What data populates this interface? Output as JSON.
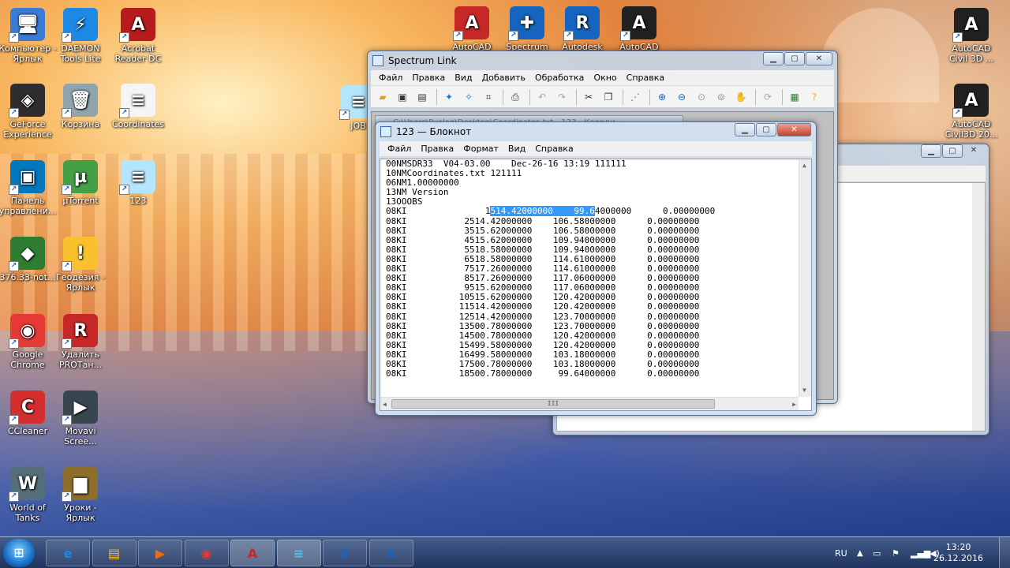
{
  "desktop_icons_left": [
    {
      "label": "Компьютер - Ярлык",
      "icon": "computer-icon",
      "color": "#3a7bd5",
      "glyph": "🖥"
    },
    {
      "label": "DAEMON Tools Lite",
      "icon": "daemon-tools-icon",
      "color": "#1e88e5",
      "glyph": "⚡"
    },
    {
      "label": "Acrobat Reader DC",
      "icon": "acrobat-icon",
      "color": "#b71c1c",
      "glyph": "A"
    },
    {
      "label": "GeForce Experience",
      "icon": "geforce-icon",
      "color": "#2e2e2e",
      "glyph": "◈"
    },
    {
      "label": "Корзина",
      "icon": "recycle-bin-icon",
      "color": "#90a4ae",
      "glyph": "🗑"
    },
    {
      "label": "Coordinates",
      "icon": "text-file-icon",
      "color": "#f5f5f5",
      "glyph": "≡"
    },
    {
      "label": "Панель управлени...",
      "icon": "intel-panel-icon",
      "color": "#0277bd",
      "glyph": "▣"
    },
    {
      "label": "µTorrent",
      "icon": "utorrent-icon",
      "color": "#43a047",
      "glyph": "µ"
    },
    {
      "label": "123",
      "icon": "notepad-file-icon",
      "color": "#b3e5fc",
      "glyph": "≡"
    },
    {
      "label": "376.33-not...",
      "icon": "nvidia-icon",
      "color": "#2e7d32",
      "glyph": "◆"
    },
    {
      "label": "Геодезия - Ярлык",
      "icon": "warning-icon",
      "color": "#fbc02d",
      "glyph": "!"
    },
    {
      "label": "Google Chrome",
      "icon": "chrome-icon",
      "color": "#e53935",
      "glyph": "◉"
    },
    {
      "label": "Удалить PROTан...",
      "icon": "uninstall-icon",
      "color": "#c62828",
      "glyph": "R"
    },
    {
      "label": "CCleaner",
      "icon": "ccleaner-icon",
      "color": "#d32f2f",
      "glyph": "C"
    },
    {
      "label": "Movavi Scree...",
      "icon": "movavi-icon",
      "color": "#37474f",
      "glyph": "▶"
    },
    {
      "label": "World of Tanks",
      "icon": "wot-icon",
      "color": "#546e7a",
      "glyph": "W"
    },
    {
      "label": "Уроки - Ярлык",
      "icon": "folder-icon",
      "color": "#8d6e2a",
      "glyph": "▆"
    }
  ],
  "desktop_icons_top": [
    {
      "label": "AutoCAD",
      "icon": "autocad-icon",
      "color": "#c62828",
      "glyph": "A"
    },
    {
      "label": "Spectrum",
      "icon": "spectrum-icon",
      "color": "#1565c0",
      "glyph": "✚"
    },
    {
      "label": "Autodesk",
      "icon": "autodesk-icon",
      "color": "#1565c0",
      "glyph": "R"
    },
    {
      "label": "AutoCAD",
      "icon": "autocad-c3d-icon",
      "color": "#212121",
      "glyph": "A"
    },
    {
      "label": "JOB",
      "icon": "job-file-icon",
      "color": "#b3e5fc",
      "glyph": "≡"
    }
  ],
  "desktop_icons_right": [
    {
      "label": "AutoCAD Civil 3D ...",
      "icon": "civil3d-icon",
      "color": "#212121",
      "glyph": "A"
    },
    {
      "label": "AutoCAD Civil3D 20...",
      "icon": "civil3d-2-icon",
      "color": "#212121",
      "glyph": "A"
    }
  ],
  "spectrum": {
    "title": "Spectrum Link",
    "menu": [
      "Файл",
      "Правка",
      "Вид",
      "Добавить",
      "Обработка",
      "Окно",
      "Справка"
    ],
    "inner_title": "C:\\Users\\Ruslan\\Desktop\\Coordinates.txt - 123 - Коорди..."
  },
  "notepad": {
    "title": "123 — Блокнот",
    "menu": [
      "Файл",
      "Правка",
      "Формат",
      "Вид",
      "Справка"
    ],
    "header_lines": [
      "00NMSDR33  V04-03.00    Dec-26-16 13:19 111111",
      "10NMCoordinates.txt 121111",
      "06NM1.00000000",
      "13NM Version",
      "13OOOBS"
    ],
    "first_row": {
      "tag": "08KI",
      "col1_pre": "1",
      "col1_sel": "514.42000000",
      "col2_sel": "99.6",
      "col2_post": "4000000",
      "col3": "0.00000000"
    },
    "rows": [
      [
        "08KI",
        "2514.42000000",
        "106.58000000",
        "0.00000000"
      ],
      [
        "08KI",
        "3515.62000000",
        "106.58000000",
        "0.00000000"
      ],
      [
        "08KI",
        "4515.62000000",
        "109.94000000",
        "0.00000000"
      ],
      [
        "08KI",
        "5518.58000000",
        "109.94000000",
        "0.00000000"
      ],
      [
        "08KI",
        "6518.58000000",
        "114.61000000",
        "0.00000000"
      ],
      [
        "08KI",
        "7517.26000000",
        "114.61000000",
        "0.00000000"
      ],
      [
        "08KI",
        "8517.26000000",
        "117.06000000",
        "0.00000000"
      ],
      [
        "08KI",
        "9515.62000000",
        "117.06000000",
        "0.00000000"
      ],
      [
        "08KI",
        "10515.62000000",
        "120.42000000",
        "0.00000000"
      ],
      [
        "08KI",
        "11514.42000000",
        "120.42000000",
        "0.00000000"
      ],
      [
        "08KI",
        "12514.42000000",
        "123.70000000",
        "0.00000000"
      ],
      [
        "08KI",
        "13500.78000000",
        "123.70000000",
        "0.00000000"
      ],
      [
        "08KI",
        "14500.78000000",
        "120.42000000",
        "0.00000000"
      ],
      [
        "08KI",
        "15499.58000000",
        "120.42000000",
        "0.00000000"
      ],
      [
        "08KI",
        "16499.58000000",
        "103.18000000",
        "0.00000000"
      ],
      [
        "08KI",
        "17500.78000000",
        "103.18000000",
        "0.00000000"
      ],
      [
        "08KI",
        "18500.78000000",
        "99.64000000",
        "0.00000000"
      ]
    ]
  },
  "taskbar": {
    "items": [
      {
        "icon": "ie-icon",
        "glyph": "e",
        "color": "#1e88e5"
      },
      {
        "icon": "explorer-icon",
        "glyph": "▤",
        "color": "#fbc02d"
      },
      {
        "icon": "media-player-icon",
        "glyph": "▶",
        "color": "#ef6c00"
      },
      {
        "icon": "chrome-icon",
        "glyph": "◉",
        "color": "#e53935"
      },
      {
        "icon": "autocad-icon",
        "glyph": "A",
        "color": "#c62828"
      },
      {
        "icon": "notepad-icon",
        "glyph": "≡",
        "color": "#4fc3f7"
      },
      {
        "icon": "sokkia-icon",
        "glyph": "S",
        "color": "#1565c0"
      },
      {
        "icon": "sokkia-icon",
        "glyph": "S",
        "color": "#1565c0"
      }
    ],
    "lang": "RU",
    "time": "13:20",
    "date": "26.12.2016"
  }
}
